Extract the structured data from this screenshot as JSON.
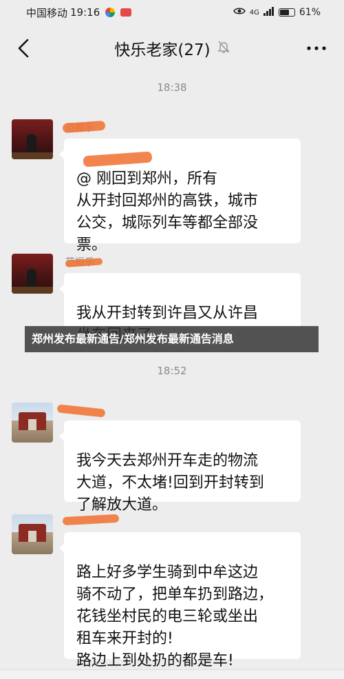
{
  "status_bar": {
    "carrier": "中国移动",
    "time": "19:16",
    "network": "4G",
    "battery": "61%",
    "battery_level": 0.61
  },
  "chat": {
    "title": "快乐老家(27)",
    "mute_icon": "bell-off-icon"
  },
  "timestamps": [
    "18:38",
    "18:52"
  ],
  "messages": [
    {
      "sender": "范振乐",
      "text": "@      刚回到郑州，所有\n从开封回郑州的高铁，城市\n公交，城际列车等都全部没\n票。"
    },
    {
      "sender": "范振乐",
      "text": "我从开封转到许昌又从许昌\n坐车回来了。"
    },
    {
      "sender": "",
      "text": "我今天去郑州开车走的物流\n大道，不太堵!回到开封转到\n了解放大道。"
    },
    {
      "sender": "",
      "text": "路上好多学生骑到中牟这边\n骑不动了，把单车扔到路边，\n花钱坐村民的电三轮或坐出\n租车来开封的!\n路边上到处扔的都是车!"
    }
  ],
  "banner": {
    "text": "郑州发布最新通告/郑州发布最新通告消息"
  },
  "colors": {
    "background": "#ededed",
    "bubble": "#ffffff",
    "scribble": "#f06e2e",
    "banner": "#303030"
  }
}
